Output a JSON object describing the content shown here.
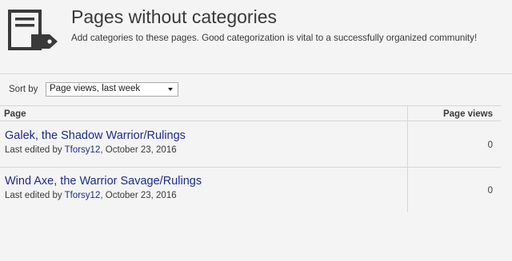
{
  "header": {
    "title": "Pages without categories",
    "subtitle": "Add categories to these pages. Good categorization is vital to a successfully organized community!",
    "icon": "page-tag-icon"
  },
  "sort": {
    "label": "Sort by",
    "selected": "Page views, last week"
  },
  "table": {
    "columns": [
      "Page",
      "Page views"
    ],
    "rows": [
      {
        "title": "Galek, the Shadow Warrior/Rulings",
        "edited_prefix": "Last edited by",
        "user": "Tforsy12",
        "date": ", October 23, 2016",
        "views": "0"
      },
      {
        "title": "Wind Axe, the Warrior Savage/Rulings",
        "edited_prefix": "Last edited by",
        "user": "Tforsy12",
        "date": ", October 23, 2016",
        "views": "0"
      }
    ]
  },
  "colors": {
    "link": "#1d2c8e",
    "text": "#3a3a3a",
    "background": "#f4f4f4"
  }
}
